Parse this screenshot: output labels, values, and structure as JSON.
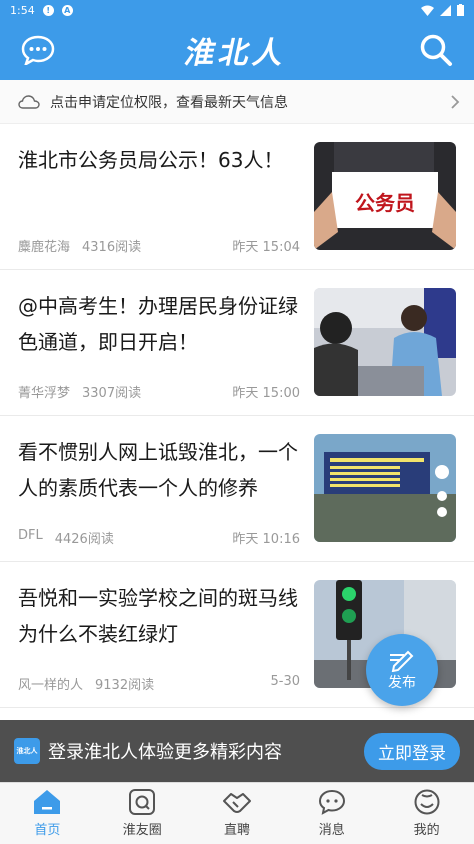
{
  "status_bar": {
    "time": "1:54"
  },
  "header": {
    "logo": "淮北人",
    "menu_icon": "chat-bubble-icon",
    "search_icon": "search-icon"
  },
  "weather": {
    "text": "点击申请定位权限，查看最新天气信息"
  },
  "articles": [
    {
      "title": "淮北市公务员局公示！63人！",
      "author": "麋鹿花海",
      "reads": "4316阅读",
      "time": "昨天 15:04",
      "thumb_text": "公务员"
    },
    {
      "title": "@中高考生！办理居民身份证绿色通道，即日开启！",
      "author": "菁华浮梦",
      "reads": "3307阅读",
      "time": "昨天 15:00"
    },
    {
      "title": "看不惯别人网上诋毁淮北，一个人的素质代表一个人的修养",
      "author": "DFL",
      "reads": "4426阅读",
      "time": "昨天 10:16"
    },
    {
      "title": "吾悦和一实验学校之间的斑马线为什么不装红绿灯",
      "author": "风一样的人",
      "reads": "9132阅读",
      "time": "5-30"
    }
  ],
  "fab": {
    "label": "发布"
  },
  "login_bar": {
    "app_logo": "淮北人",
    "text": "登录淮北人体验更多精彩内容",
    "button": "立即登录"
  },
  "tabs": [
    {
      "label": "首页",
      "icon": "home-icon",
      "active": true
    },
    {
      "label": "淮友圈",
      "icon": "circle-icon",
      "active": false
    },
    {
      "label": "直聘",
      "icon": "handshake-icon",
      "active": false
    },
    {
      "label": "消息",
      "icon": "message-icon",
      "active": false
    },
    {
      "label": "我的",
      "icon": "profile-icon",
      "active": false
    }
  ],
  "colors": {
    "brand": "#3d9be9"
  }
}
